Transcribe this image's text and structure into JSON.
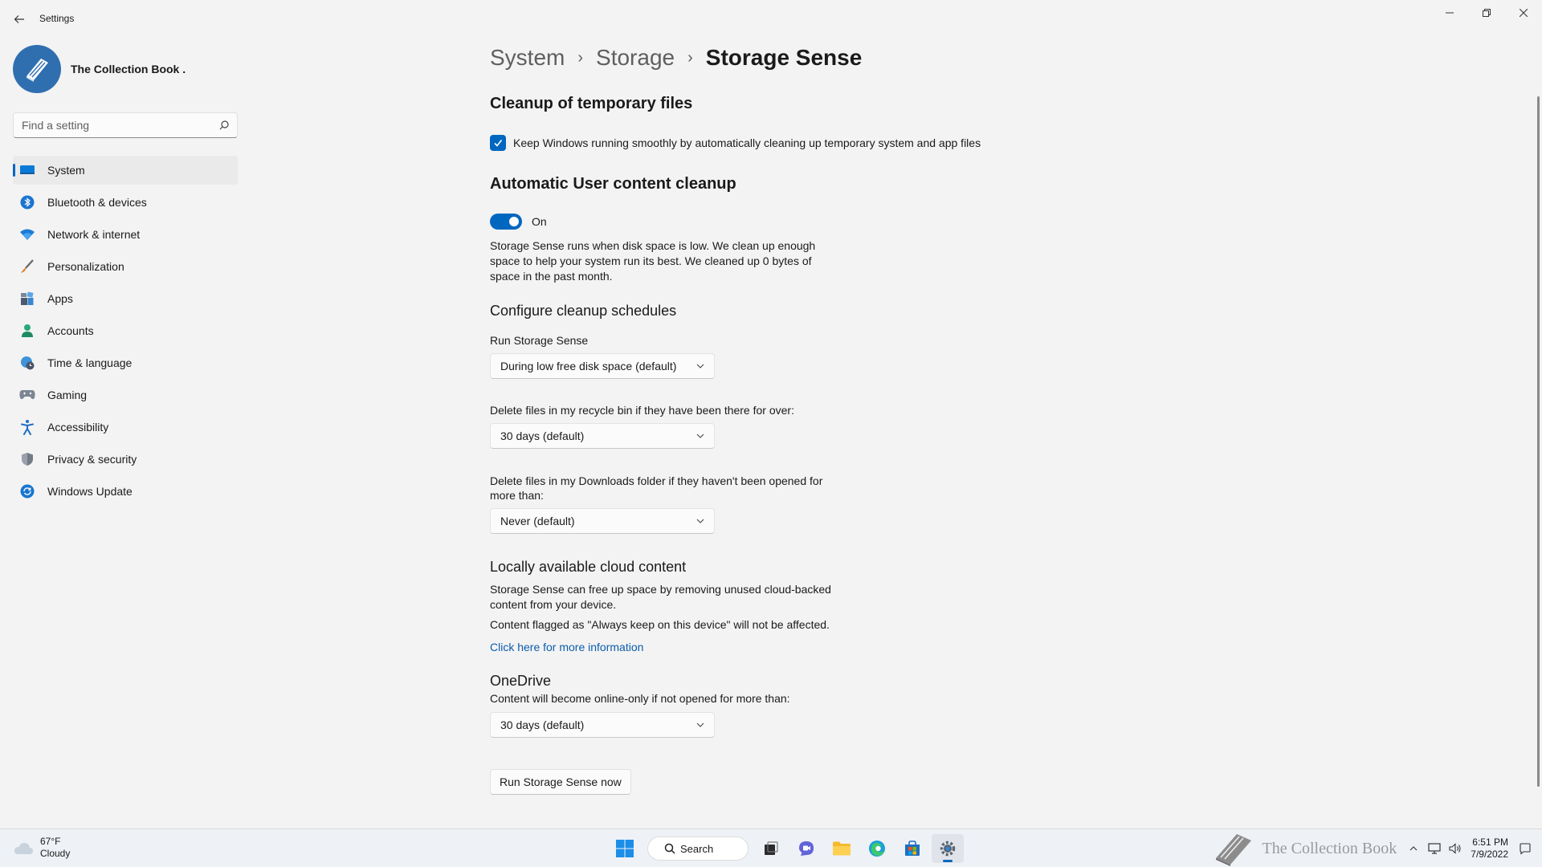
{
  "window": {
    "title": "Settings"
  },
  "sidebar": {
    "account_name": "The Collection Book .",
    "search_placeholder": "Find a setting",
    "items": [
      {
        "label": "System",
        "icon": "system-icon",
        "active": true
      },
      {
        "label": "Bluetooth & devices",
        "icon": "bluetooth-icon"
      },
      {
        "label": "Network & internet",
        "icon": "wifi-icon"
      },
      {
        "label": "Personalization",
        "icon": "brush-icon"
      },
      {
        "label": "Apps",
        "icon": "apps-icon"
      },
      {
        "label": "Accounts",
        "icon": "person-icon"
      },
      {
        "label": "Time & language",
        "icon": "globe-clock-icon"
      },
      {
        "label": "Gaming",
        "icon": "gamepad-icon"
      },
      {
        "label": "Accessibility",
        "icon": "accessibility-icon"
      },
      {
        "label": "Privacy & security",
        "icon": "shield-icon"
      },
      {
        "label": "Windows Update",
        "icon": "update-icon"
      }
    ]
  },
  "breadcrumb": {
    "items": [
      "System",
      "Storage"
    ],
    "current": "Storage Sense"
  },
  "cleanup_temp": {
    "heading": "Cleanup of temporary files",
    "checkbox_label": "Keep Windows running smoothly by automatically cleaning up temporary system and app files",
    "checked": true
  },
  "auto_cleanup": {
    "heading": "Automatic User content cleanup",
    "toggle_label": "On",
    "toggle_on": true,
    "description": "Storage Sense runs when disk space is low. We clean up enough space to help your system run its best. We cleaned up 0 bytes of space in the past month."
  },
  "schedules": {
    "heading": "Configure cleanup schedules",
    "run_label": "Run Storage Sense",
    "run_value": "During low free disk space (default)",
    "recycle_label": "Delete files in my recycle bin if they have been there for over:",
    "recycle_value": "30 days (default)",
    "downloads_label": "Delete files in my Downloads folder if they haven't been opened for more than:",
    "downloads_value": "Never (default)"
  },
  "cloud": {
    "heading": "Locally available cloud content",
    "description": "Storage Sense can free up space by removing unused cloud-backed content from your device.",
    "note": "Content flagged as \"Always keep on this device\" will not be affected.",
    "link": "Click here for more information"
  },
  "onedrive": {
    "heading": "OneDrive",
    "label": "Content will become online-only if not opened for more than:",
    "value": "30 days (default)"
  },
  "run_now_button": "Run Storage Sense now",
  "taskbar": {
    "temperature": "67°F",
    "condition": "Cloudy",
    "search_label": "Search",
    "watermark": "The Collection Book",
    "time": "6:51 PM",
    "date": "7/9/2022"
  },
  "colors": {
    "accent": "#0067c0",
    "link": "#0b5cad"
  }
}
